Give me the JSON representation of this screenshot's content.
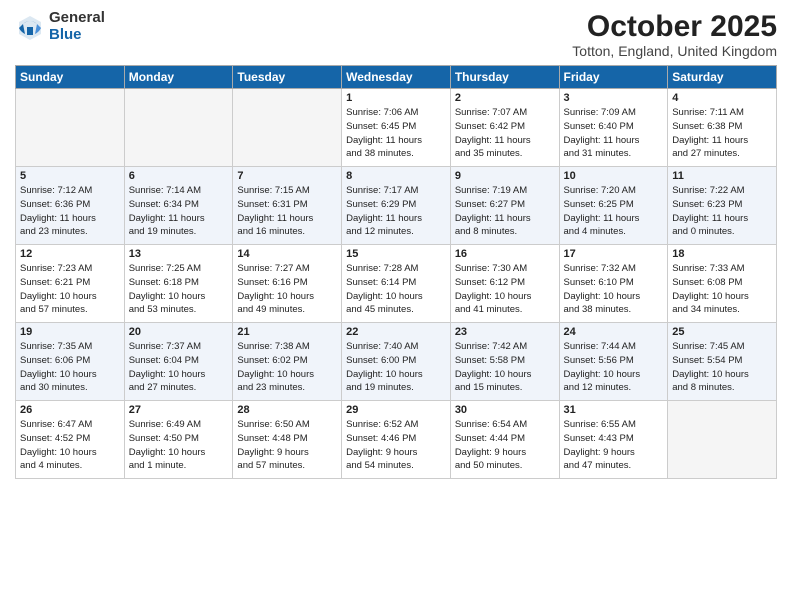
{
  "logo": {
    "general": "General",
    "blue": "Blue"
  },
  "title": "October 2025",
  "location": "Totton, England, United Kingdom",
  "days_of_week": [
    "Sunday",
    "Monday",
    "Tuesday",
    "Wednesday",
    "Thursday",
    "Friday",
    "Saturday"
  ],
  "weeks": [
    [
      {
        "day": "",
        "info": ""
      },
      {
        "day": "",
        "info": ""
      },
      {
        "day": "",
        "info": ""
      },
      {
        "day": "1",
        "info": "Sunrise: 7:06 AM\nSunset: 6:45 PM\nDaylight: 11 hours\nand 38 minutes."
      },
      {
        "day": "2",
        "info": "Sunrise: 7:07 AM\nSunset: 6:42 PM\nDaylight: 11 hours\nand 35 minutes."
      },
      {
        "day": "3",
        "info": "Sunrise: 7:09 AM\nSunset: 6:40 PM\nDaylight: 11 hours\nand 31 minutes."
      },
      {
        "day": "4",
        "info": "Sunrise: 7:11 AM\nSunset: 6:38 PM\nDaylight: 11 hours\nand 27 minutes."
      }
    ],
    [
      {
        "day": "5",
        "info": "Sunrise: 7:12 AM\nSunset: 6:36 PM\nDaylight: 11 hours\nand 23 minutes."
      },
      {
        "day": "6",
        "info": "Sunrise: 7:14 AM\nSunset: 6:34 PM\nDaylight: 11 hours\nand 19 minutes."
      },
      {
        "day": "7",
        "info": "Sunrise: 7:15 AM\nSunset: 6:31 PM\nDaylight: 11 hours\nand 16 minutes."
      },
      {
        "day": "8",
        "info": "Sunrise: 7:17 AM\nSunset: 6:29 PM\nDaylight: 11 hours\nand 12 minutes."
      },
      {
        "day": "9",
        "info": "Sunrise: 7:19 AM\nSunset: 6:27 PM\nDaylight: 11 hours\nand 8 minutes."
      },
      {
        "day": "10",
        "info": "Sunrise: 7:20 AM\nSunset: 6:25 PM\nDaylight: 11 hours\nand 4 minutes."
      },
      {
        "day": "11",
        "info": "Sunrise: 7:22 AM\nSunset: 6:23 PM\nDaylight: 11 hours\nand 0 minutes."
      }
    ],
    [
      {
        "day": "12",
        "info": "Sunrise: 7:23 AM\nSunset: 6:21 PM\nDaylight: 10 hours\nand 57 minutes."
      },
      {
        "day": "13",
        "info": "Sunrise: 7:25 AM\nSunset: 6:18 PM\nDaylight: 10 hours\nand 53 minutes."
      },
      {
        "day": "14",
        "info": "Sunrise: 7:27 AM\nSunset: 6:16 PM\nDaylight: 10 hours\nand 49 minutes."
      },
      {
        "day": "15",
        "info": "Sunrise: 7:28 AM\nSunset: 6:14 PM\nDaylight: 10 hours\nand 45 minutes."
      },
      {
        "day": "16",
        "info": "Sunrise: 7:30 AM\nSunset: 6:12 PM\nDaylight: 10 hours\nand 41 minutes."
      },
      {
        "day": "17",
        "info": "Sunrise: 7:32 AM\nSunset: 6:10 PM\nDaylight: 10 hours\nand 38 minutes."
      },
      {
        "day": "18",
        "info": "Sunrise: 7:33 AM\nSunset: 6:08 PM\nDaylight: 10 hours\nand 34 minutes."
      }
    ],
    [
      {
        "day": "19",
        "info": "Sunrise: 7:35 AM\nSunset: 6:06 PM\nDaylight: 10 hours\nand 30 minutes."
      },
      {
        "day": "20",
        "info": "Sunrise: 7:37 AM\nSunset: 6:04 PM\nDaylight: 10 hours\nand 27 minutes."
      },
      {
        "day": "21",
        "info": "Sunrise: 7:38 AM\nSunset: 6:02 PM\nDaylight: 10 hours\nand 23 minutes."
      },
      {
        "day": "22",
        "info": "Sunrise: 7:40 AM\nSunset: 6:00 PM\nDaylight: 10 hours\nand 19 minutes."
      },
      {
        "day": "23",
        "info": "Sunrise: 7:42 AM\nSunset: 5:58 PM\nDaylight: 10 hours\nand 15 minutes."
      },
      {
        "day": "24",
        "info": "Sunrise: 7:44 AM\nSunset: 5:56 PM\nDaylight: 10 hours\nand 12 minutes."
      },
      {
        "day": "25",
        "info": "Sunrise: 7:45 AM\nSunset: 5:54 PM\nDaylight: 10 hours\nand 8 minutes."
      }
    ],
    [
      {
        "day": "26",
        "info": "Sunrise: 6:47 AM\nSunset: 4:52 PM\nDaylight: 10 hours\nand 4 minutes."
      },
      {
        "day": "27",
        "info": "Sunrise: 6:49 AM\nSunset: 4:50 PM\nDaylight: 10 hours\nand 1 minute."
      },
      {
        "day": "28",
        "info": "Sunrise: 6:50 AM\nSunset: 4:48 PM\nDaylight: 9 hours\nand 57 minutes."
      },
      {
        "day": "29",
        "info": "Sunrise: 6:52 AM\nSunset: 4:46 PM\nDaylight: 9 hours\nand 54 minutes."
      },
      {
        "day": "30",
        "info": "Sunrise: 6:54 AM\nSunset: 4:44 PM\nDaylight: 9 hours\nand 50 minutes."
      },
      {
        "day": "31",
        "info": "Sunrise: 6:55 AM\nSunset: 4:43 PM\nDaylight: 9 hours\nand 47 minutes."
      },
      {
        "day": "",
        "info": ""
      }
    ]
  ]
}
